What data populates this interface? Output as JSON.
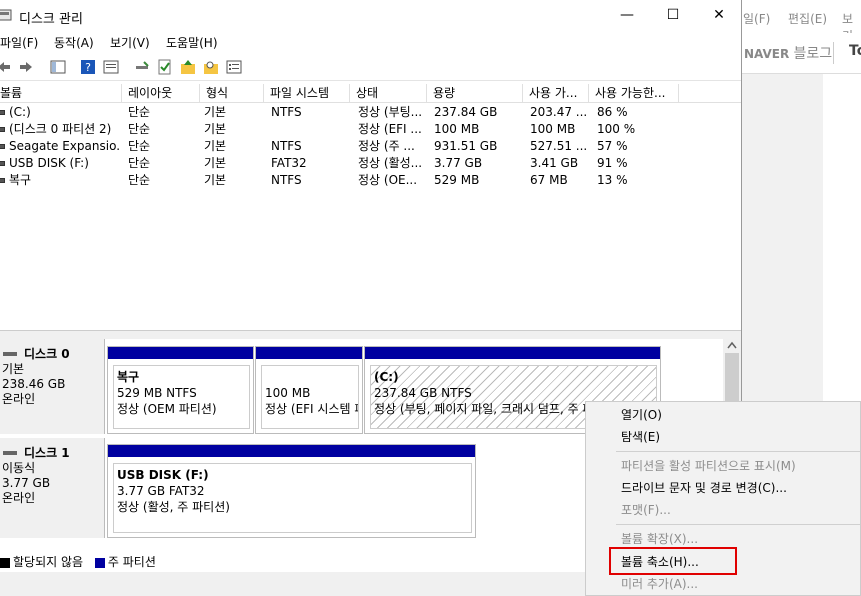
{
  "background_window": {
    "menu_items": [
      "일(F)",
      "편집(E)",
      "보기(V)"
    ],
    "naver_brand": "NAVER",
    "naver_blog": "블로그",
    "tab_text": "To"
  },
  "window": {
    "title": "디스크 관리",
    "controls": {
      "minimize": "—",
      "maximize": "☐",
      "close": "✕"
    },
    "menu": [
      "파일(F)",
      "동작(A)",
      "보기(V)",
      "도움말(H)"
    ]
  },
  "volume_list": {
    "columns": [
      "볼륨",
      "레이아웃",
      "형식",
      "파일 시스템",
      "상태",
      "용량",
      "사용 가...",
      "사용 가능한..."
    ],
    "rows": [
      [
        "(C:)",
        "단순",
        "기본",
        "NTFS",
        "정상 (부팅...",
        "237.84 GB",
        "203.47 ...",
        "86 %"
      ],
      [
        "(디스크 0 파티션 2)",
        "단순",
        "기본",
        "",
        "정상 (EFI ...",
        "100 MB",
        "100 MB",
        "100 %"
      ],
      [
        "Seagate Expansio...",
        "단순",
        "기본",
        "NTFS",
        "정상 (주 ...",
        "931.51 GB",
        "527.51 ...",
        "57 %"
      ],
      [
        "USB DISK (F:)",
        "단순",
        "기본",
        "FAT32",
        "정상 (활성...",
        "3.77 GB",
        "3.41 GB",
        "91 %"
      ],
      [
        "복구",
        "단순",
        "기본",
        "NTFS",
        "정상 (OE...",
        "529 MB",
        "67 MB",
        "13 %"
      ]
    ]
  },
  "disks": [
    {
      "name": "디스크 0",
      "type": "기본",
      "size": "238.46 GB",
      "status": "온라인",
      "partitions": [
        {
          "label": "복구",
          "size": "529 MB NTFS",
          "status": "정상 (OEM 파티션)"
        },
        {
          "label": "",
          "size": "100 MB",
          "status": "정상 (EFI 시스템 파"
        },
        {
          "label": "(C:)",
          "size": "237.84 GB NTFS",
          "status": "정상 (부팅, 페이지 파일, 크래시 덤프, 주 파티션)"
        }
      ]
    },
    {
      "name": "디스크 1",
      "type": "이동식",
      "size": "3.77 GB",
      "status": "온라인",
      "partitions": [
        {
          "label": "USB DISK  (F:)",
          "size": "3.77 GB FAT32",
          "status": "정상 (활성, 주 파티션)"
        }
      ]
    }
  ],
  "legend": {
    "unallocated": "할당되지 않음",
    "primary": "주 파티션",
    "unallocated_color": "#000000",
    "primary_color": "#0000a0"
  },
  "context_menu": {
    "items": [
      {
        "label": "열기(O)",
        "enabled": true
      },
      {
        "label": "탐색(E)",
        "enabled": true
      },
      {
        "label": "파티션을 활성 파티션으로 표시(M)",
        "enabled": false
      },
      {
        "label": "드라이브 문자 및 경로 변경(C)...",
        "enabled": true
      },
      {
        "label": "포맷(F)...",
        "enabled": false
      },
      {
        "label": "볼륨 확장(X)...",
        "enabled": false
      },
      {
        "label": "볼륨 축소(H)...",
        "enabled": true,
        "highlighted": true
      },
      {
        "label": "미러 추가(A)...",
        "enabled": false
      }
    ],
    "highlight_color": "#e00000"
  }
}
